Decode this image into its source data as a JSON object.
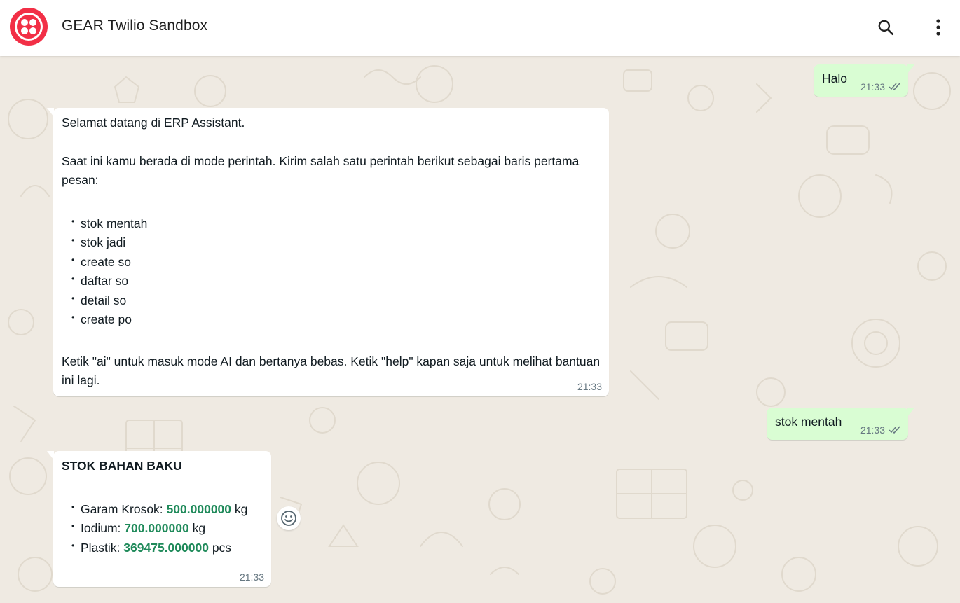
{
  "header": {
    "title": "GEAR Twilio Sandbox",
    "search_icon": "search-icon",
    "menu_icon": "more-vertical-icon"
  },
  "colors": {
    "brand": "#f22f46",
    "incoming_bubble": "#ffffff",
    "outgoing_bubble": "#d9fdd3",
    "chat_background": "#efeae2",
    "value_green": "#1f8a5a",
    "read_tick": "#667781"
  },
  "messages": [
    {
      "direction": "outgoing",
      "text": "Halo",
      "time": "21:33",
      "status_icon": "double-check-icon"
    },
    {
      "direction": "incoming",
      "intro": "Selamat datang di ERP Assistant.",
      "paragraph": "Saat ini kamu berada di mode perintah. Kirim salah satu perintah berikut sebagai baris pertama pesan:",
      "commands": [
        "stok mentah",
        "stok jadi",
        "create so",
        "daftar so",
        "detail so",
        "create po"
      ],
      "footer": "Ketik \"ai\" untuk masuk mode AI dan bertanya bebas. Ketik \"help\" kapan saja untuk melihat bantuan ini lagi.",
      "time": "21:33"
    },
    {
      "direction": "outgoing",
      "text": "stok mentah",
      "time": "21:33",
      "status_icon": "double-check-icon"
    },
    {
      "direction": "incoming",
      "title": "STOK BAHAN BAKU",
      "items": [
        {
          "name": "Garam Krosok:",
          "value": "500.000000",
          "unit": "kg"
        },
        {
          "name": "Iodium:",
          "value": "700.000000",
          "unit": "kg"
        },
        {
          "name": "Plastik:",
          "value": "369475.000000",
          "unit": "pcs"
        }
      ],
      "time": "21:33",
      "react_icon": "emoji-smile-icon"
    }
  ],
  "bullet_glyph": "•"
}
